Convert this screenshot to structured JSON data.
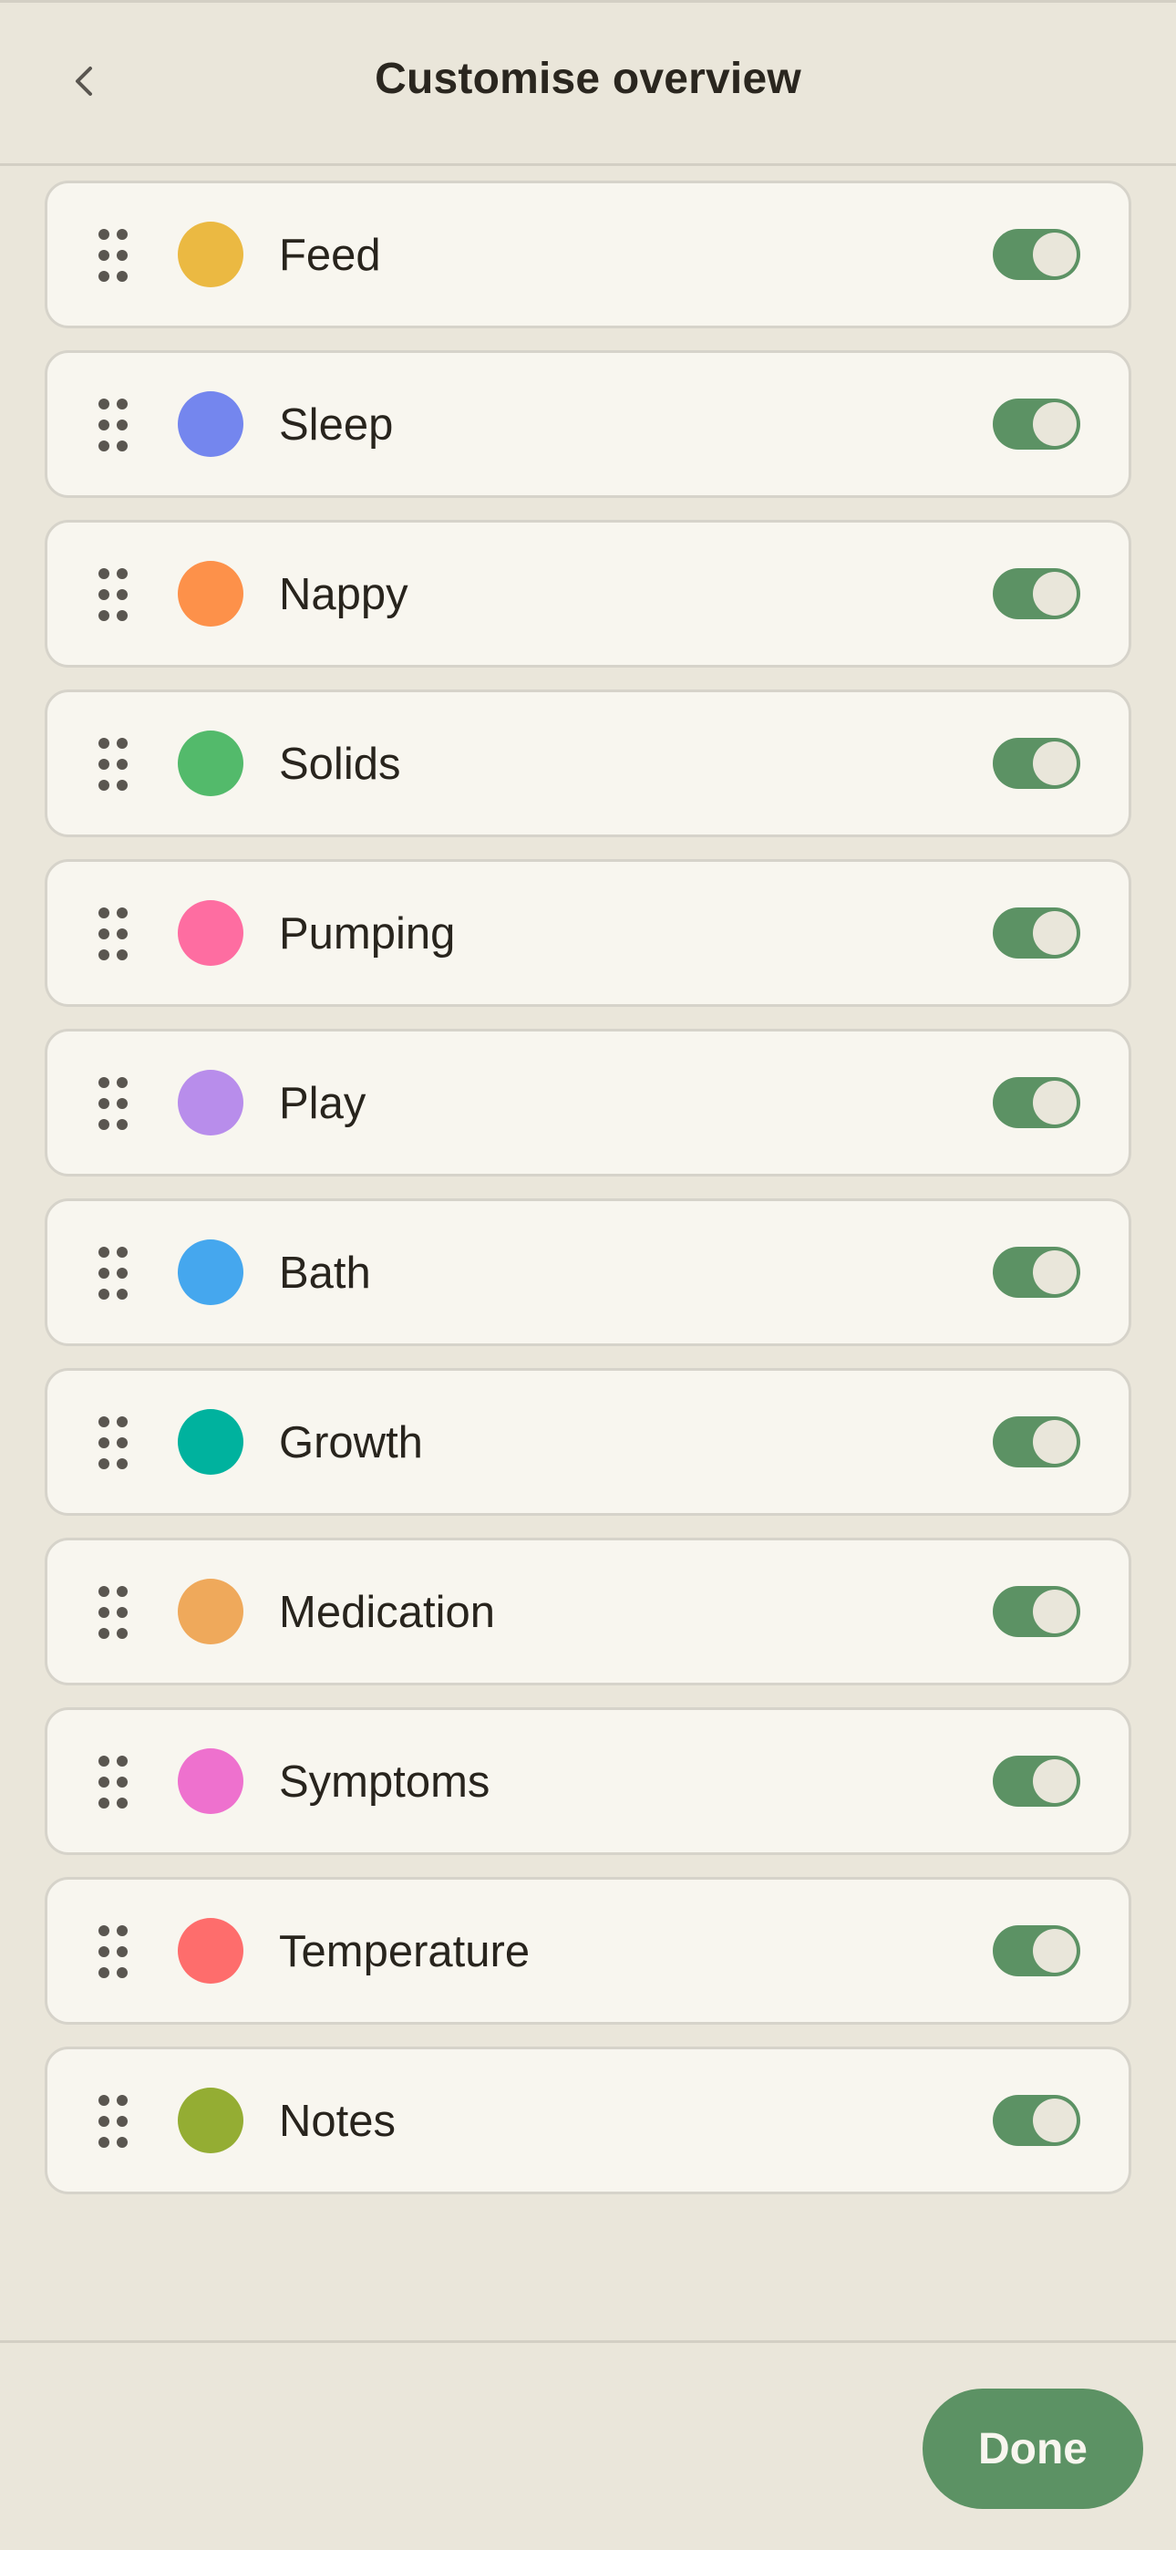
{
  "header": {
    "title": "Customise overview",
    "back_icon": "chevron-left-icon"
  },
  "items": [
    {
      "label": "Feed",
      "color": "#EBB942",
      "enabled": true
    },
    {
      "label": "Sleep",
      "color": "#7486EE",
      "enabled": true
    },
    {
      "label": "Nappy",
      "color": "#FD914A",
      "enabled": true
    },
    {
      "label": "Solids",
      "color": "#53BA6B",
      "enabled": true
    },
    {
      "label": "Pumping",
      "color": "#FE6DA1",
      "enabled": true
    },
    {
      "label": "Play",
      "color": "#B88DEB",
      "enabled": true
    },
    {
      "label": "Bath",
      "color": "#45A7EE",
      "enabled": true
    },
    {
      "label": "Growth",
      "color": "#00B29E",
      "enabled": true
    },
    {
      "label": "Medication",
      "color": "#EFA95B",
      "enabled": true
    },
    {
      "label": "Symptoms",
      "color": "#EE71CE",
      "enabled": true
    },
    {
      "label": "Temperature",
      "color": "#FE6D6C",
      "enabled": true
    },
    {
      "label": "Notes",
      "color": "#94AD33",
      "enabled": true
    }
  ],
  "footer": {
    "done_label": "Done"
  },
  "colors": {
    "background": "#EAE6DA",
    "card": "#F8F6EF",
    "accent": "#5C9264"
  }
}
